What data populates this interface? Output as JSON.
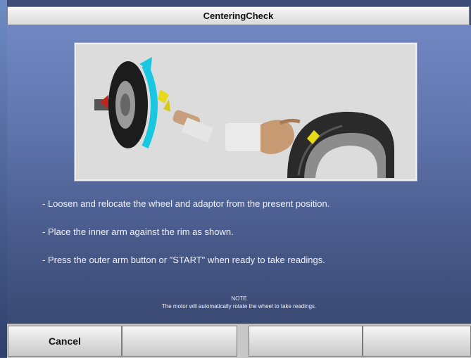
{
  "window": {
    "title": "CenteringCheck"
  },
  "instructions": [
    "- Loosen and relocate the wheel and adaptor from the present position.",
    "- Place the inner arm against the rim as shown.",
    "- Press the outer arm button or \"START\" when ready to take readings."
  ],
  "note": {
    "heading": "NOTE",
    "text": "The motor will automatically rotate the wheel to take readings."
  },
  "function_keys": [
    {
      "label": "Cancel"
    },
    {
      "label": ""
    },
    {
      "label": ""
    },
    {
      "label": ""
    }
  ],
  "colors": {
    "background": "#4a5b8c",
    "rotation_arrow": "#19c8e0",
    "sensor": "#e8d81a"
  }
}
